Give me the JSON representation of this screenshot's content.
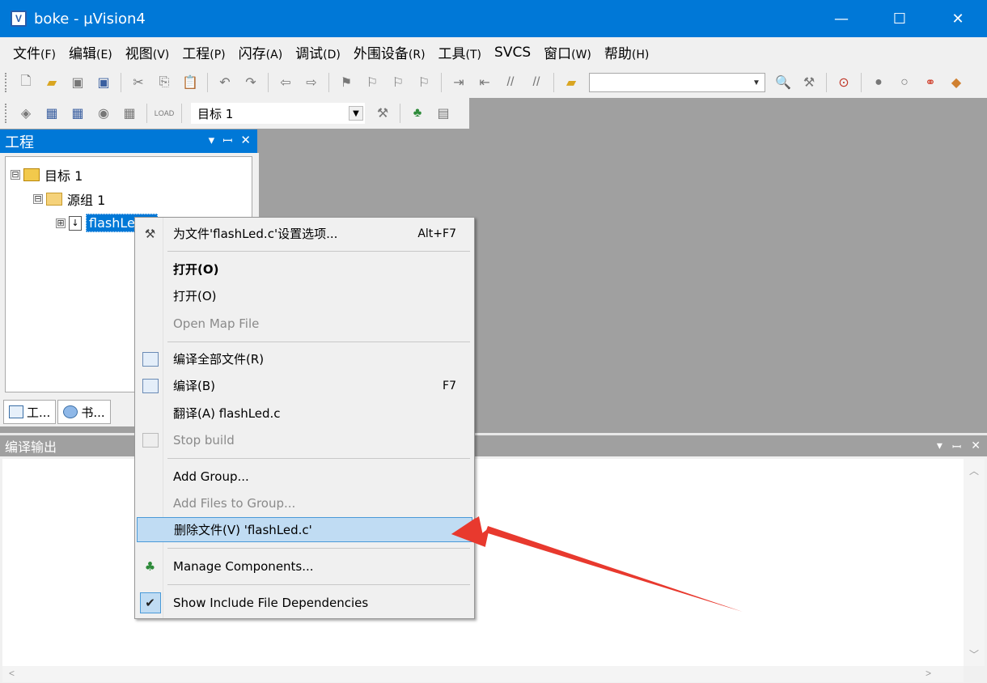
{
  "window": {
    "title": "boke  - µVision4",
    "app_icon_glyph": "V"
  },
  "window_controls": {
    "minimize": "—",
    "maximize": "☐",
    "close": "✕"
  },
  "menubar": [
    {
      "label": "文件",
      "accel": "(F)"
    },
    {
      "label": "编辑",
      "accel": "(E)"
    },
    {
      "label": "视图",
      "accel": "(V)"
    },
    {
      "label": "工程",
      "accel": "(P)"
    },
    {
      "label": "闪存",
      "accel": "(A)"
    },
    {
      "label": "调试",
      "accel": "(D)"
    },
    {
      "label": "外围设备",
      "accel": "(R)"
    },
    {
      "label": "工具",
      "accel": "(T)"
    },
    {
      "label": "SVCS",
      "accel": ""
    },
    {
      "label": "窗口",
      "accel": "(W)"
    },
    {
      "label": "帮助",
      "accel": "(H)"
    }
  ],
  "toolbar2": {
    "target_select": "目标 1"
  },
  "project_panel": {
    "title": "工程",
    "header_buttons": {
      "dropdown": "▾",
      "pin": "ꟷ",
      "close": "✕"
    },
    "tree": {
      "target": {
        "expander": "⊟",
        "label": "目标 1"
      },
      "group": {
        "expander": "⊟",
        "label": "源组 1"
      },
      "file": {
        "expander": "⊞",
        "label": "flashLed.c"
      }
    },
    "tabs": [
      {
        "label": "工..."
      },
      {
        "label": "书..."
      }
    ]
  },
  "build_output": {
    "title": "编译输出",
    "header_buttons": {
      "dropdown": "▾",
      "pin": "ꟷ",
      "close": "✕"
    }
  },
  "context_menu": {
    "items": [
      {
        "label": "为文件'flashLed.c'设置选项...",
        "shortcut": "Alt+F7",
        "icon": "options-icon",
        "state": "normal"
      },
      {
        "label": "打开(O)",
        "shortcut": "",
        "icon": "",
        "state": "bold"
      },
      {
        "label": "打开(O)",
        "shortcut": "",
        "icon": "",
        "state": "normal"
      },
      {
        "label": "Open Map File",
        "shortcut": "",
        "icon": "",
        "state": "disabled"
      },
      {
        "label": "编译全部文件(R)",
        "shortcut": "",
        "icon": "rebuild-icon",
        "state": "normal"
      },
      {
        "label": "编译(B)",
        "shortcut": "F7",
        "icon": "build-icon",
        "state": "normal"
      },
      {
        "label": "翻译(A) flashLed.c",
        "shortcut": "",
        "icon": "",
        "state": "normal"
      },
      {
        "label": "Stop build",
        "shortcut": "",
        "icon": "stop-build-icon",
        "state": "disabled"
      },
      {
        "label": "Add Group...",
        "shortcut": "",
        "icon": "",
        "state": "normal"
      },
      {
        "label": "Add Files to Group...",
        "shortcut": "",
        "icon": "",
        "state": "disabled"
      },
      {
        "label": "删除文件(V) 'flashLed.c'",
        "shortcut": "",
        "icon": "",
        "state": "highlighted"
      },
      {
        "label": "Manage Components...",
        "shortcut": "",
        "icon": "components-icon",
        "state": "normal"
      },
      {
        "label": "Show Include File Dependencies",
        "shortcut": "",
        "icon": "checkmark-icon",
        "state": "checked"
      }
    ]
  },
  "colors": {
    "titlebar": "#0078d7",
    "highlight": "#c0dcf3",
    "annotation_arrow": "#e8392e"
  }
}
